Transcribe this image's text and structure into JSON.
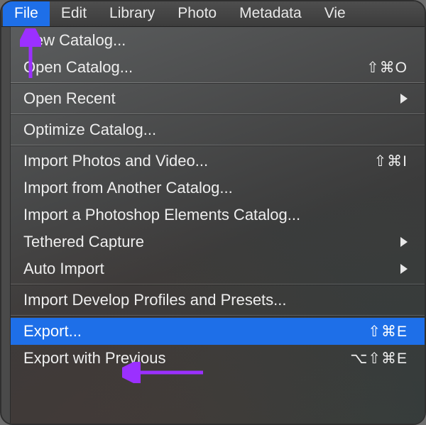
{
  "colors": {
    "highlight": "#1e6fe8",
    "annotation": "#9b30ff"
  },
  "menubar": {
    "items": [
      {
        "label": "File",
        "active": true
      },
      {
        "label": "Edit",
        "active": false
      },
      {
        "label": "Library",
        "active": false
      },
      {
        "label": "Photo",
        "active": false
      },
      {
        "label": "Metadata",
        "active": false
      },
      {
        "label": "Vie",
        "active": false
      }
    ]
  },
  "dropdown": {
    "items": [
      {
        "type": "item",
        "label": "New Catalog...",
        "shortcut": "",
        "submenu": false,
        "highlight": false
      },
      {
        "type": "item",
        "label": "Open Catalog...",
        "shortcut": "⇧⌘O",
        "submenu": false,
        "highlight": false
      },
      {
        "type": "sep"
      },
      {
        "type": "item",
        "label": "Open Recent",
        "shortcut": "",
        "submenu": true,
        "highlight": false
      },
      {
        "type": "sep"
      },
      {
        "type": "item",
        "label": "Optimize Catalog...",
        "shortcut": "",
        "submenu": false,
        "highlight": false
      },
      {
        "type": "sep"
      },
      {
        "type": "item",
        "label": "Import Photos and Video...",
        "shortcut": "⇧⌘I",
        "submenu": false,
        "highlight": false
      },
      {
        "type": "item",
        "label": "Import from Another Catalog...",
        "shortcut": "",
        "submenu": false,
        "highlight": false
      },
      {
        "type": "item",
        "label": "Import a Photoshop Elements Catalog...",
        "shortcut": "",
        "submenu": false,
        "highlight": false
      },
      {
        "type": "item",
        "label": "Tethered Capture",
        "shortcut": "",
        "submenu": true,
        "highlight": false
      },
      {
        "type": "item",
        "label": "Auto Import",
        "shortcut": "",
        "submenu": true,
        "highlight": false
      },
      {
        "type": "sep"
      },
      {
        "type": "item",
        "label": "Import Develop Profiles and Presets...",
        "shortcut": "",
        "submenu": false,
        "highlight": false
      },
      {
        "type": "sep"
      },
      {
        "type": "item",
        "label": "Export...",
        "shortcut": "⇧⌘E",
        "submenu": false,
        "highlight": true
      },
      {
        "type": "item",
        "label": "Export with Previous",
        "shortcut": "⌥⇧⌘E",
        "submenu": false,
        "highlight": false
      }
    ]
  }
}
